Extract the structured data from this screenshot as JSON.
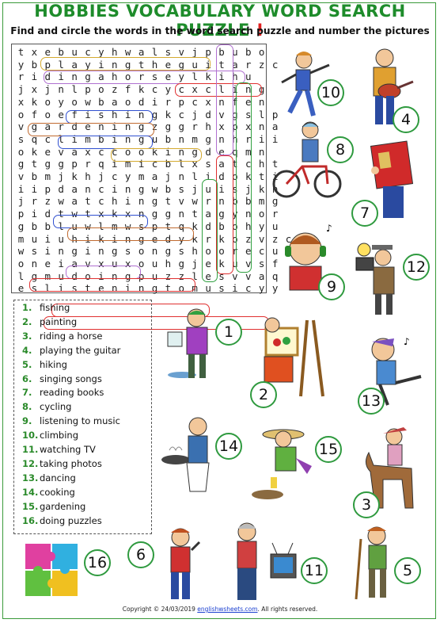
{
  "title": "HOBBIES VOCABULARY WORD SEARCH PUZZLE",
  "title_mark": "!",
  "subtitle": "Find and circle the words in the word search puzzle and number the pictures",
  "grid": [
    "txebucyhwalsvjpbubo",
    "ybplayingtheguitarzc",
    "ridingahorseylkihu",
    "jxjnlpozfkcycxcling",
    "xkoyowbaodirpcxnfen",
    "ofoefishingkcjdvgslp",
    "vgardeningzggrhxpxna",
    "sqclimbingubnmgnhrii",
    "okevaxccookingdeqmn",
    "gtggprqimicblxsatcht",
    "vbmjkhjcymajnlidokti",
    "iipdancingwbsjuisjkn",
    "jrzwatchingtvwrnbbmg",
    "pidtwtxkxnggntagynor",
    "gbbluwlmwsptqkdbohyu",
    "muiuhikingedykrkozvzc",
    "wsingingsongshoorecu",
    "oneiavxuxouhgjekuvsf",
    "lgmudoingpuzzlesvvaq",
    "eslisteningtomusicyy"
  ],
  "answers": [
    {
      "n": "1.",
      "word": "fishing"
    },
    {
      "n": "2.",
      "word": "painting"
    },
    {
      "n": "3.",
      "word": "riding a horse"
    },
    {
      "n": "4.",
      "word": "playing the guitar"
    },
    {
      "n": "5.",
      "word": "hiking"
    },
    {
      "n": "6.",
      "word": "singing songs"
    },
    {
      "n": "7.",
      "word": "reading books"
    },
    {
      "n": "8.",
      "word": "cycling"
    },
    {
      "n": "9.",
      "word": "listening to music"
    },
    {
      "n": "10.",
      "word": "climbing"
    },
    {
      "n": "11.",
      "word": "watching TV"
    },
    {
      "n": "12.",
      "word": "taking photos"
    },
    {
      "n": "13.",
      "word": "dancing"
    },
    {
      "n": "14.",
      "word": "cooking"
    },
    {
      "n": "15.",
      "word": "gardening"
    },
    {
      "n": "16.",
      "word": "doing puzzles"
    }
  ],
  "picture_numbers": [
    "10",
    "4",
    "8",
    "7",
    "9",
    "12",
    "1",
    "2",
    "13",
    "14",
    "15",
    "3",
    "16",
    "6",
    "11",
    "5"
  ],
  "copyright": {
    "prefix": "Copyright © 24/03/2019",
    "site": "englishwsheets.com",
    "suffix": ". All rights reserved."
  },
  "colors": {
    "title": "#1e8c2b",
    "title_mark": "#e02020",
    "number_circle": "#2f9a3f"
  }
}
